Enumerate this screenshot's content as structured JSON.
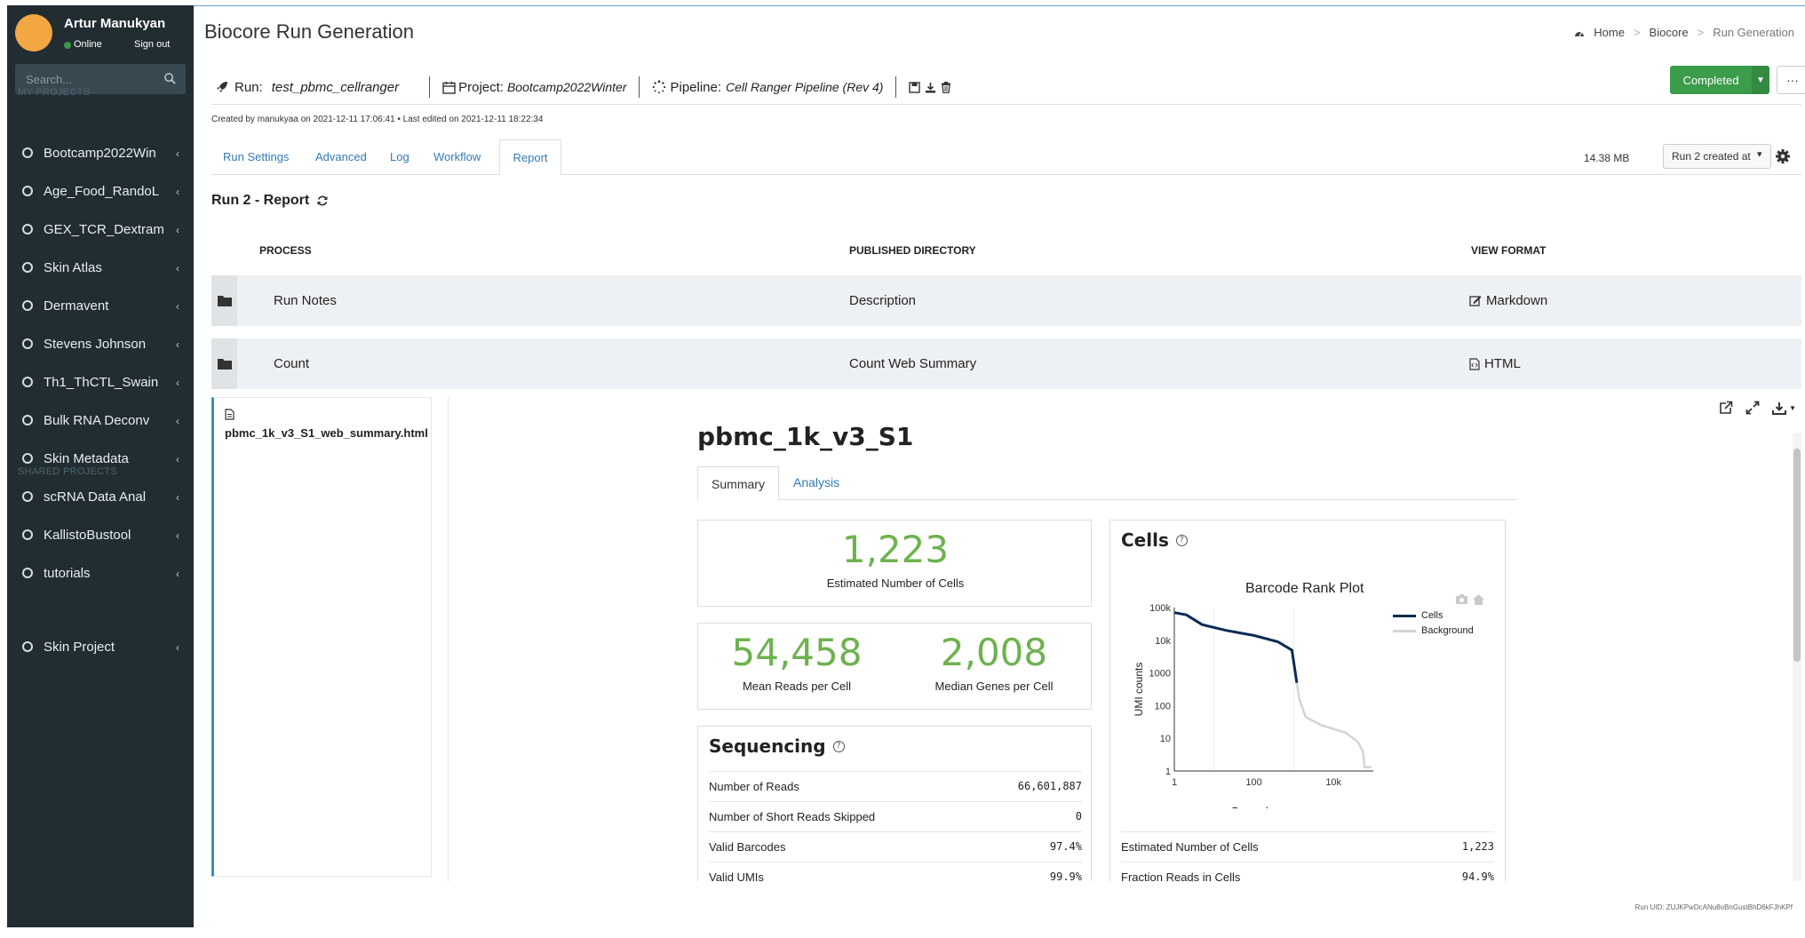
{
  "user": {
    "name": "Artur Manukyan",
    "status": "Online",
    "signout": "Sign out"
  },
  "search": {
    "placeholder": "Search..."
  },
  "sidebar": {
    "my_projects_header": "MY PROJECTS",
    "shared_projects_header": "SHARED PROJECTS",
    "my_projects": [
      {
        "label": "Bootcamp2022Win"
      },
      {
        "label": "Age_Food_RandoL"
      },
      {
        "label": "GEX_TCR_Dextram"
      },
      {
        "label": "Skin Atlas"
      },
      {
        "label": "Dermavent"
      },
      {
        "label": "Stevens Johnson"
      },
      {
        "label": "Th1_ThCTL_Swain"
      },
      {
        "label": "Bulk RNA Deconv"
      },
      {
        "label": "Skin Metadata"
      },
      {
        "label": "scRNA Data Anal"
      },
      {
        "label": "KallistoBustool"
      },
      {
        "label": "tutorials"
      }
    ],
    "shared_projects": [
      {
        "label": "Skin Project"
      }
    ]
  },
  "header": {
    "title": "Biocore Run Generation",
    "breadcrumb": {
      "home": "Home",
      "parent": "Biocore",
      "current": "Run Generation"
    }
  },
  "run": {
    "run_label": "Run:",
    "run_name": "test_pbmc_cellranger",
    "project_label": "Project:",
    "project_name": "Bootcamp2022Winter",
    "pipeline_label": "Pipeline:",
    "pipeline_name": "Cell Ranger Pipeline (Rev 4)",
    "status": "Completed",
    "created_info": "Created by manukyaa on 2021-12-11 17:06:41 • Last edited on 2021-12-11 18:22:34"
  },
  "tabs": {
    "run_settings": "Run Settings",
    "advanced": "Advanced",
    "log": "Log",
    "workflow": "Workflow",
    "report": "Report"
  },
  "size": "14.38 MB",
  "run_select": {
    "value": "Run 2 created at"
  },
  "report": {
    "title": "Run 2 - Report",
    "columns": {
      "process": "PROCESS",
      "published": "PUBLISHED DIRECTORY",
      "view": "VIEW FORMAT"
    },
    "rows": [
      {
        "process": "Run Notes",
        "directory": "Description",
        "format": "Markdown"
      },
      {
        "process": "Count",
        "directory": "Count Web Summary",
        "format": "HTML"
      }
    ],
    "file_name": "pbmc_1k_v3_S1_web_summary.html"
  },
  "web_summary": {
    "sample": "pbmc_1k_v3_S1",
    "tabs": {
      "summary": "Summary",
      "analysis": "Analysis"
    },
    "estimated_cells": {
      "value": "1,223",
      "label": "Estimated Number of Cells"
    },
    "mean_reads": {
      "value": "54,458",
      "label": "Mean Reads per Cell"
    },
    "median_genes": {
      "value": "2,008",
      "label": "Median Genes per Cell"
    },
    "sequencing": {
      "title": "Sequencing",
      "rows": [
        {
          "key": "Number of Reads",
          "value": "66,601,887"
        },
        {
          "key": "Number of Short Reads Skipped",
          "value": "0"
        },
        {
          "key": "Valid Barcodes",
          "value": "97.4%"
        },
        {
          "key": "Valid UMIs",
          "value": "99.9%"
        }
      ]
    },
    "cells": {
      "title": "Cells",
      "rows": [
        {
          "key": "Estimated Number of Cells",
          "value": "1,223"
        },
        {
          "key": "Fraction Reads in Cells",
          "value": "94.9%"
        }
      ]
    }
  },
  "chart_data": {
    "type": "line",
    "title": "Barcode Rank Plot",
    "xlabel": "Barcodes",
    "ylabel": "UMI counts",
    "x_scale": "log",
    "y_scale": "log",
    "x_ticks": [
      "1",
      "100",
      "10k"
    ],
    "y_ticks": [
      "100k",
      "10k",
      "1000",
      "100",
      "10",
      "1"
    ],
    "xlim": [
      1,
      100000
    ],
    "ylim": [
      1,
      100000
    ],
    "legend_position": "top-right",
    "series": [
      {
        "name": "Cells",
        "color": "#0b2a54",
        "x": [
          1,
          2,
          5,
          20,
          100,
          400,
          900,
          1200
        ],
        "y": [
          70000,
          60000,
          30000,
          20000,
          14000,
          9000,
          5000,
          500
        ]
      },
      {
        "name": "Background",
        "color": "#d4d4d4",
        "x": [
          1200,
          1400,
          2000,
          5000,
          20000,
          40000,
          55000,
          60000,
          90000
        ],
        "y": [
          500,
          150,
          45,
          25,
          15,
          8,
          4,
          1.3,
          1.3
        ]
      }
    ]
  },
  "footer": {
    "uid": "Run UID: ZUJKPwDcANu8oBnGustBhD6kFJhKPf"
  }
}
